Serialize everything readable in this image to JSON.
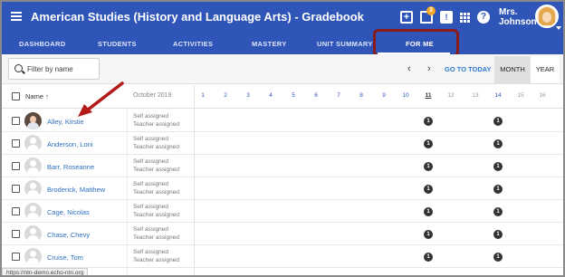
{
  "header": {
    "title": "American Studies (History and Language Arts) - Gradebook",
    "notification_count": "3",
    "user_name_line1": "Mrs.",
    "user_name_line2": "Johnson"
  },
  "nav": {
    "tabs": [
      {
        "label": "DASHBOARD",
        "active": false
      },
      {
        "label": "STUDENTS",
        "active": false
      },
      {
        "label": "ACTIVITIES",
        "active": false
      },
      {
        "label": "MASTERY",
        "active": false
      },
      {
        "label": "UNIT SUMMARY",
        "active": false
      },
      {
        "label": "FOR ME",
        "active": true
      }
    ]
  },
  "toolbar": {
    "filter_placeholder": "Filter by name",
    "prev_icon": "chevron-left-icon",
    "next_icon": "chevron-right-icon",
    "goto_today": "GO TO TODAY",
    "month_label": "MONTH",
    "year_label": "YEAR",
    "selected_view": "MONTH"
  },
  "table": {
    "name_header": "Name",
    "sort_icon": "arrow-up-icon",
    "month_header": "October 2019",
    "days": [
      "1",
      "2",
      "3",
      "4",
      "5",
      "6",
      "7",
      "8",
      "9",
      "10",
      "11",
      "12",
      "13",
      "14",
      "15",
      "16"
    ],
    "grey_days": [
      "12",
      "13",
      "15",
      "16"
    ],
    "today_day": "11",
    "rows": [
      {
        "name": "Alley, Kirstie",
        "line1": "Self assigned",
        "line2": "Teacher assigned",
        "photo": true,
        "marks": {
          "11": "1",
          "14": "1"
        }
      },
      {
        "name": "Anderson, Loni",
        "line1": "Self assigned",
        "line2": "Teacher assigned",
        "photo": false,
        "marks": {
          "11": "1",
          "14": "1"
        }
      },
      {
        "name": "Barr, Roseanne",
        "line1": "Self assigned",
        "line2": "Teacher assigned",
        "photo": false,
        "marks": {
          "11": "1",
          "14": "1"
        }
      },
      {
        "name": "Broderick, Matthew",
        "line1": "Self assigned",
        "line2": "Teacher assigned",
        "photo": false,
        "marks": {
          "11": "1",
          "14": "1"
        }
      },
      {
        "name": "Cage, Nicolas",
        "line1": "Self assigned",
        "line2": "Teacher assigned",
        "photo": false,
        "marks": {
          "11": "1",
          "14": "1"
        }
      },
      {
        "name": "Chase, Chevy",
        "line1": "Self assigned",
        "line2": "Teacher assigned",
        "photo": false,
        "marks": {
          "11": "1",
          "14": "1"
        }
      },
      {
        "name": "Cruise, Tom",
        "line1": "Self assigned",
        "line2": "Teacher assigned",
        "photo": false,
        "marks": {
          "11": "1",
          "14": "1"
        }
      }
    ]
  },
  "status_bar": {
    "url": "https://ntn-demo.echo-ntn.org"
  },
  "colors": {
    "brand": "#2f55b8",
    "highlight": "#8b1a1a",
    "link": "#2f6fc0"
  }
}
